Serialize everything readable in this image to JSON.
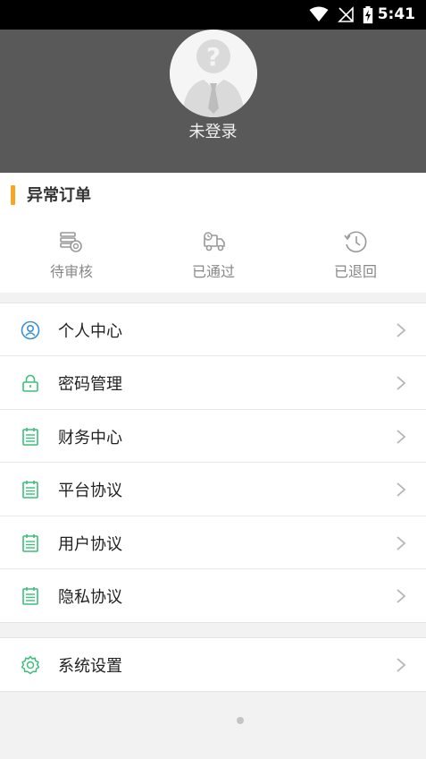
{
  "status_bar": {
    "time": "5:41",
    "icons": [
      "wifi-icon",
      "no-signal-icon",
      "battery-charging-icon"
    ]
  },
  "header": {
    "avatar_icon": "question-avatar-icon",
    "login_status": "未登录"
  },
  "abnormal_orders": {
    "title": "异常订单",
    "accent_color": "#f5a623",
    "items": [
      {
        "label": "待审核",
        "icon": "coins-icon"
      },
      {
        "label": "已通过",
        "icon": "delivery-truck-icon"
      },
      {
        "label": "已退回",
        "icon": "history-clock-icon"
      }
    ]
  },
  "menu": {
    "accent_color": "#3cbf7a",
    "group1": [
      {
        "label": "个人中心",
        "icon": "user-circle-icon"
      },
      {
        "label": "密码管理",
        "icon": "lock-icon"
      },
      {
        "label": "财务中心",
        "icon": "document-list-icon"
      },
      {
        "label": "平台协议",
        "icon": "document-list-icon"
      },
      {
        "label": "用户协议",
        "icon": "document-list-icon"
      },
      {
        "label": "隐私协议",
        "icon": "document-list-icon"
      }
    ],
    "group2": [
      {
        "label": "系统设置",
        "icon": "gear-icon"
      }
    ]
  }
}
